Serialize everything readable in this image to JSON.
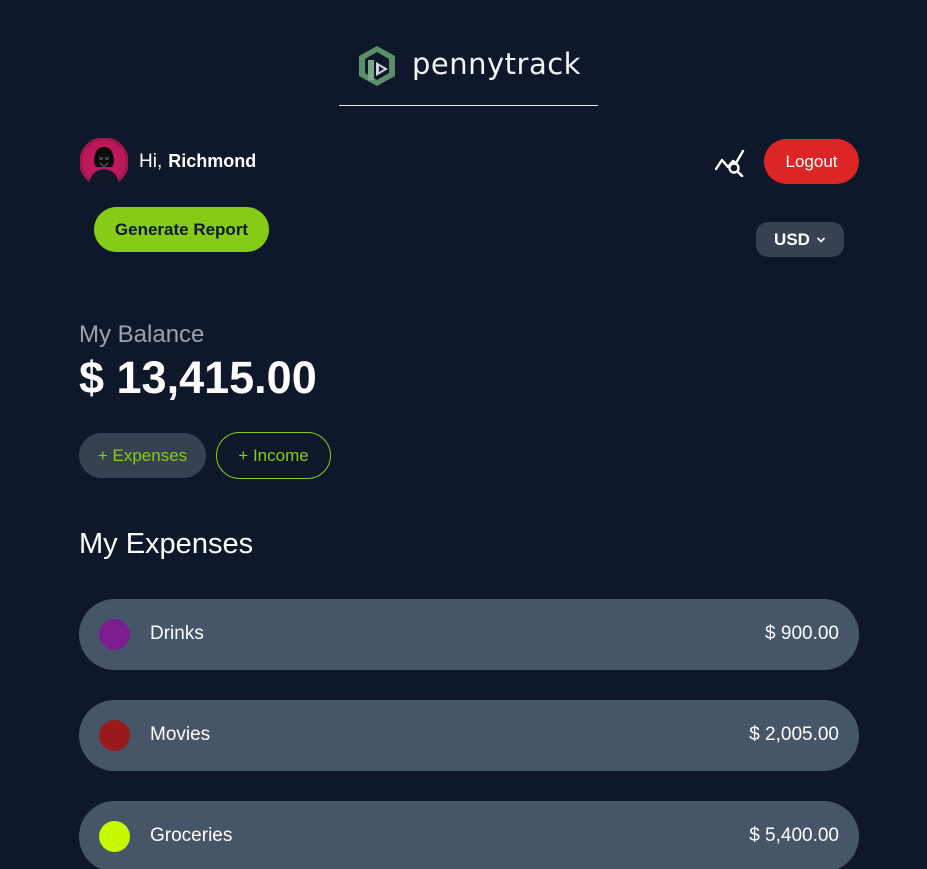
{
  "brand": {
    "name": "pennytrack"
  },
  "user": {
    "greeting": "Hi,",
    "name": "Richmond"
  },
  "header": {
    "logout_label": "Logout"
  },
  "actions": {
    "report_label": "Generate Report"
  },
  "currency": {
    "selected": "USD"
  },
  "balance": {
    "label": "My Balance",
    "value": "$ 13,415.00"
  },
  "buttons": {
    "expenses_label": "+ Expenses",
    "income_label": "+ Income"
  },
  "expenses": {
    "title": "My Expenses",
    "items": [
      {
        "name": "Drinks",
        "amount": "$ 900.00",
        "color": "#7c1d8f"
      },
      {
        "name": "Movies",
        "amount": "$ 2,005.00",
        "color": "#991b1b"
      },
      {
        "name": "Groceries",
        "amount": "$ 5,400.00",
        "color": "#c6f800"
      }
    ]
  },
  "colors": {
    "background": "#0f172a",
    "accent": "#84cc16",
    "danger": "#dc2626",
    "row": "#475569"
  }
}
